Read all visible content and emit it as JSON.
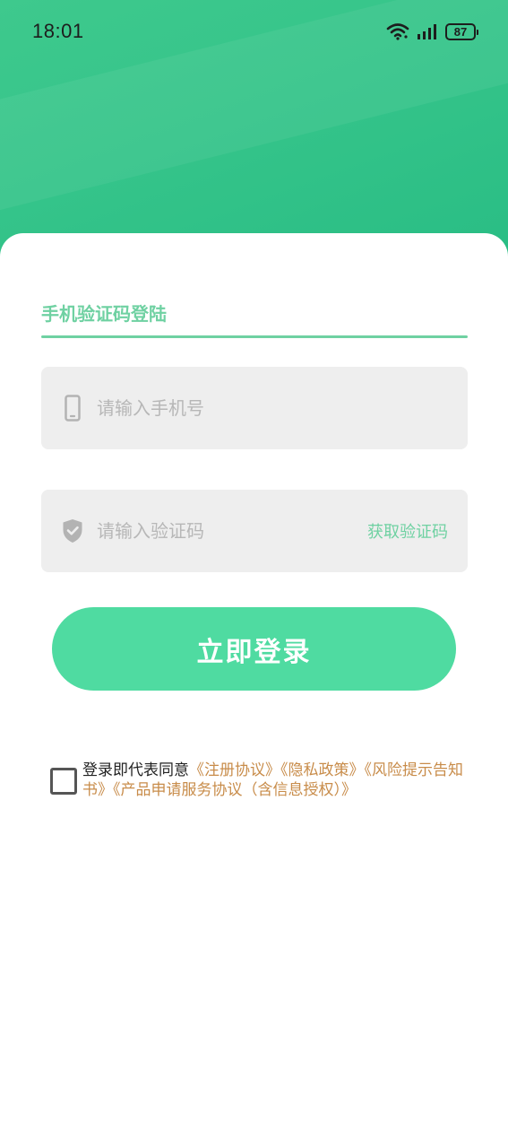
{
  "status_bar": {
    "time": "18:01",
    "battery": "87",
    "icons": [
      "wifi-icon",
      "signal-icon",
      "battery-icon"
    ]
  },
  "colors": {
    "header_green": "#35c48a",
    "accent_green": "#6fd1a2",
    "button_green": "#4fdba1",
    "link_brown": "#c88c4a",
    "input_bg": "#eeeeee"
  },
  "login": {
    "tab_title": "手机验证码登陆",
    "phone": {
      "icon": "phone-icon",
      "value": "",
      "placeholder": "请输入手机号"
    },
    "code": {
      "icon": "shield-check-icon",
      "value": "",
      "placeholder": "请输入验证码",
      "get_code_label": "获取验证码"
    },
    "submit_label": "立即登录"
  },
  "agreement": {
    "checked": false,
    "prefix": "登录即代表同意",
    "links": [
      "《注册协议》",
      "《隐私政策》",
      "《风险提示告知书》",
      "《产品申请服务协议（含信息授权）》"
    ]
  }
}
